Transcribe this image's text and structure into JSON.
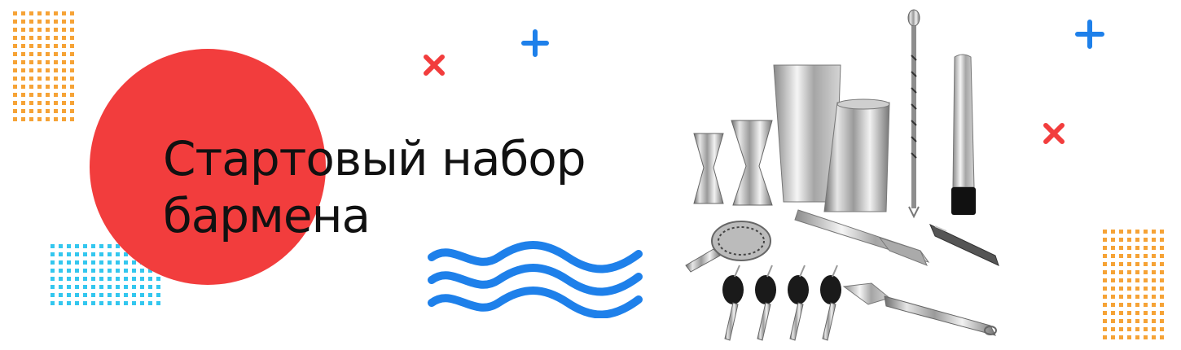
{
  "banner": {
    "headline_line1": "Стартовый набор",
    "headline_line2": "бармена"
  },
  "colors": {
    "accent_red": "#f23d3d",
    "accent_blue": "#1e80ea",
    "dots_orange": "#f6a336",
    "dots_cyan": "#33c7ef",
    "text": "#111111"
  },
  "decor": {
    "plus_icon": "plus-icon",
    "cross_icon": "cross-icon",
    "wave_icon": "wave-icon",
    "dot_grid": "dot-grid"
  }
}
